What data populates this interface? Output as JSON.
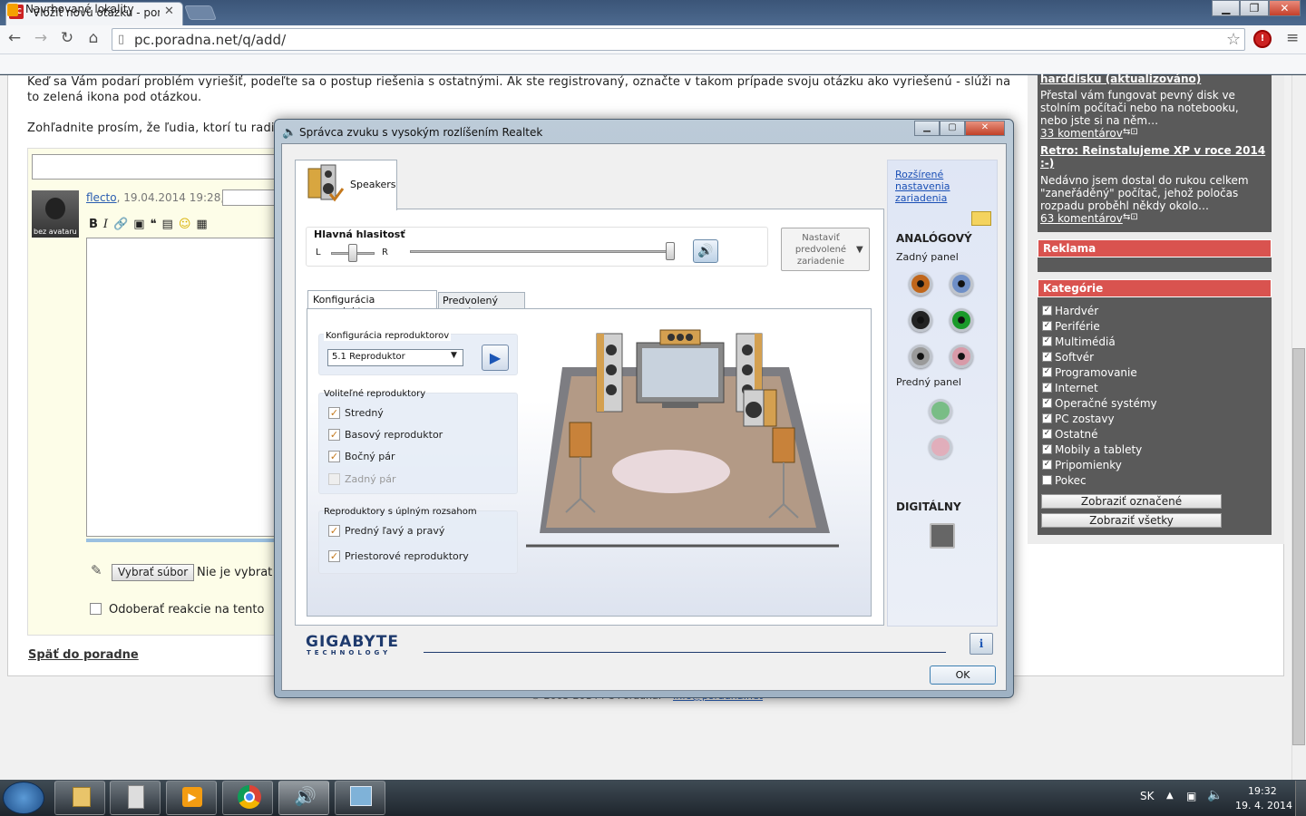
{
  "browser": {
    "tab_title": "Vložiť novú otázku - porad",
    "url": "pc.poradna.net/q/add/",
    "bookmark": "Navrhované lokality",
    "window_controls": [
      "minimize-icon",
      "maximize-icon",
      "close-icon"
    ]
  },
  "page": {
    "intro_line1": "Keď sa Vám podarí problém vyriešiť, podeľte sa o postup riešenia s ostatnými. Ak ste registrovaný, označte v takom prípade svoju otázku ako vyriešenú - slúži na",
    "intro_line2": "to zelená ikona pod otázkou.",
    "notice": "Zohľadnite prosím, že ľudia, ktorí tu radia",
    "author": "flecto",
    "date": ", 19.04.2014 19:28,",
    "avatar_label": "bez avataru",
    "choose_file": "Vybrať súbor",
    "no_file": "Nie je vybrat",
    "subscribe": "Odoberať reakcie na tento",
    "back_link": "Späť do poradne",
    "footer_left": "© 2003-2014 PC Poradna.",
    "footer_link": "Info@poradna.net"
  },
  "sidebar": {
    "top_title": "harddisku (aktualizováno)",
    "top_text": "Přestal vám fungovat pevný disk ve stolním počítači nebo na notebooku, nebo jste si na něm…",
    "top_comments": "33 komentárov",
    "retro_title": "Retro: Reinstalujeme XP v roce 2014 :-)",
    "retro_text": "Nedávno jsem dostal do rukou celkem \"zaneřáděný\" počítač, jehož poločas rozpadu proběhl někdy okolo…",
    "retro_comments": "63 komentárov",
    "reklama": "Reklama",
    "kategorie": "Kategórie",
    "categories": [
      {
        "label": "Hardvér",
        "checked": "✓"
      },
      {
        "label": "Periférie",
        "checked": "✓"
      },
      {
        "label": "Multimédiá",
        "checked": "✓"
      },
      {
        "label": "Softvér",
        "checked": "✓"
      },
      {
        "label": "Programovanie",
        "checked": "✓"
      },
      {
        "label": "Internet",
        "checked": "✓"
      },
      {
        "label": "Operačné systémy",
        "checked": "✓"
      },
      {
        "label": "PC zostavy",
        "checked": "✓"
      },
      {
        "label": "Ostatné",
        "checked": "✓"
      },
      {
        "label": "Mobily a tablety",
        "checked": "✓"
      },
      {
        "label": "Pripomienky",
        "checked": "✓"
      },
      {
        "label": "Pokec",
        "checked": ""
      }
    ],
    "btn_marked": "Zobraziť označené",
    "btn_all": "Zobraziť všetky"
  },
  "dialog": {
    "title": "Správca zvuku s vysokým rozlíšením Realtek",
    "tab_speakers": "Speakers",
    "main_volume": "Hlavná hlasitosť",
    "bal_left": "L",
    "bal_right": "R",
    "volume_level": 1.0,
    "balance_level": 0.5,
    "default_device": "Nastaviť predvolené zariadenie",
    "subtab_config": "Konfigurácia reproduktorov",
    "subtab_format": "Predvolený formát",
    "config_group": "Konfigurácia reproduktorov",
    "config_value": "5.1 Reproduktor",
    "optional_group": "Voliteľné reproduktory",
    "optional": [
      {
        "label": "Stredný",
        "checked": "✓"
      },
      {
        "label": "Basový reproduktor",
        "checked": "✓"
      },
      {
        "label": "Bočný pár",
        "checked": "✓"
      },
      {
        "label": "Zadný pár",
        "checked": ""
      }
    ],
    "fullrange_group": "Reproduktory s úplným rozsahom",
    "fullrange": [
      {
        "label": "Predný ľavý a pravý",
        "checked": "✓"
      },
      {
        "label": "Priestorové reproduktory",
        "checked": "✓"
      }
    ],
    "advanced_link": "Rozšírené nastavenia zariadenia",
    "analog": "ANALÓGOVÝ",
    "rear_panel": "Zadný panel",
    "front_panel": "Predný panel",
    "digital": "DIGITÁLNY",
    "jack_colors": {
      "rear": [
        "#c0661b",
        "#6f8fc7",
        "#222222",
        "#1a9a2a",
        "#9a9a9a",
        "#d89aa8"
      ],
      "front": [
        "#5fb26b",
        "#e0a0ad"
      ]
    },
    "brand": "GIGABYTE",
    "brand_sub": "TECHNOLOGY",
    "ok": "OK"
  },
  "taskbar": {
    "lang": "SK",
    "time": "19:32",
    "date": "19. 4. 2014"
  }
}
